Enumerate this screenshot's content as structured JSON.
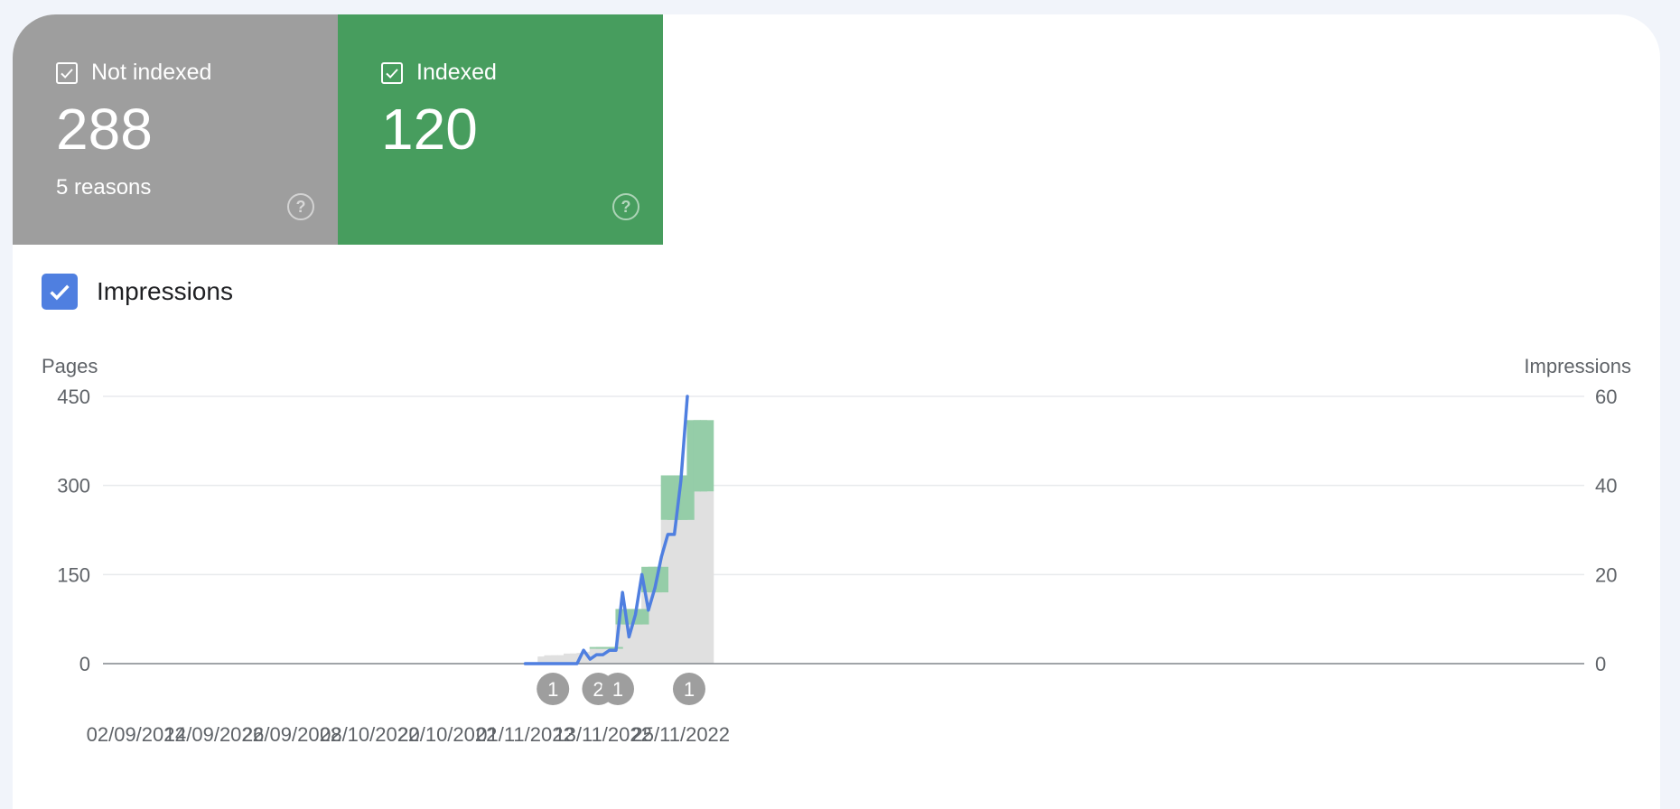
{
  "tiles": {
    "not_indexed": {
      "label": "Not indexed",
      "value": "288",
      "sub": "5 reasons",
      "checked": true,
      "color": "#9e9e9e"
    },
    "indexed": {
      "label": "Indexed",
      "value": "120",
      "checked": true,
      "color": "#479d5e"
    }
  },
  "toggle": {
    "label": "Impressions",
    "checked": true,
    "color": "#4f7fe0"
  },
  "chart_data": {
    "type": "bar",
    "y_left_label": "Pages",
    "y_right_label": "Impressions",
    "y_left_ticks": [
      "450",
      "300",
      "150",
      "0"
    ],
    "y_right_ticks": [
      "60",
      "40",
      "20",
      "0"
    ],
    "ylim_left": [
      0,
      450
    ],
    "ylim_right": [
      0,
      60
    ],
    "x_tick_labels": [
      "02/09/2022",
      "14/09/2022",
      "26/09/2022",
      "08/10/2022",
      "20/10/2022",
      "01/11/2022",
      "13/11/2022",
      "25/11/2022"
    ],
    "x_start": "2022-09-01",
    "x_end": "2022-11-30",
    "grid": true,
    "series": [
      {
        "name": "Not indexed",
        "color": "#e0e0e0",
        "points": [
          [
            "2022-11-04",
            12
          ],
          [
            "2022-11-05",
            14
          ],
          [
            "2022-11-06",
            14
          ],
          [
            "2022-11-07",
            14
          ],
          [
            "2022-11-08",
            17
          ],
          [
            "2022-11-09",
            17
          ],
          [
            "2022-11-10",
            18
          ],
          [
            "2022-11-11",
            20
          ],
          [
            "2022-11-12",
            25
          ],
          [
            "2022-11-13",
            25
          ],
          [
            "2022-11-14",
            25
          ],
          [
            "2022-11-15",
            25
          ],
          [
            "2022-11-16",
            66
          ],
          [
            "2022-11-17",
            66
          ],
          [
            "2022-11-18",
            66
          ],
          [
            "2022-11-19",
            66
          ],
          [
            "2022-11-20",
            120
          ],
          [
            "2022-11-21",
            120
          ],
          [
            "2022-11-22",
            120
          ],
          [
            "2022-11-23",
            242
          ],
          [
            "2022-11-24",
            242
          ],
          [
            "2022-11-25",
            242
          ],
          [
            "2022-11-26",
            242
          ],
          [
            "2022-11-27",
            290
          ],
          [
            "2022-11-28",
            290
          ],
          [
            "2022-11-29",
            290
          ]
        ]
      },
      {
        "name": "Indexed",
        "color": "#95cda8",
        "points": [
          [
            "2022-11-12",
            3
          ],
          [
            "2022-11-13",
            3
          ],
          [
            "2022-11-14",
            3
          ],
          [
            "2022-11-15",
            3
          ],
          [
            "2022-11-16",
            26
          ],
          [
            "2022-11-17",
            26
          ],
          [
            "2022-11-18",
            26
          ],
          [
            "2022-11-19",
            26
          ],
          [
            "2022-11-20",
            43
          ],
          [
            "2022-11-21",
            43
          ],
          [
            "2022-11-22",
            43
          ],
          [
            "2022-11-23",
            75
          ],
          [
            "2022-11-24",
            75
          ],
          [
            "2022-11-25",
            75
          ],
          [
            "2022-11-26",
            75
          ],
          [
            "2022-11-27",
            120
          ],
          [
            "2022-11-28",
            120
          ],
          [
            "2022-11-29",
            120
          ]
        ]
      },
      {
        "name": "Impressions",
        "color": "#4f7fe0",
        "axis": "right",
        "points": [
          [
            "2022-11-01",
            0
          ],
          [
            "2022-11-02",
            0
          ],
          [
            "2022-11-03",
            0
          ],
          [
            "2022-11-04",
            0
          ],
          [
            "2022-11-05",
            0
          ],
          [
            "2022-11-06",
            0
          ],
          [
            "2022-11-07",
            0
          ],
          [
            "2022-11-08",
            0
          ],
          [
            "2022-11-09",
            0
          ],
          [
            "2022-11-10",
            3
          ],
          [
            "2022-11-11",
            1
          ],
          [
            "2022-11-12",
            2
          ],
          [
            "2022-11-13",
            2
          ],
          [
            "2022-11-14",
            3
          ],
          [
            "2022-11-15",
            3
          ],
          [
            "2022-11-16",
            16
          ],
          [
            "2022-11-17",
            6
          ],
          [
            "2022-11-18",
            11
          ],
          [
            "2022-11-19",
            20
          ],
          [
            "2022-11-20",
            12
          ],
          [
            "2022-11-21",
            17
          ],
          [
            "2022-11-22",
            24
          ],
          [
            "2022-11-23",
            29
          ],
          [
            "2022-11-24",
            29
          ],
          [
            "2022-11-25",
            41
          ],
          [
            "2022-11-26",
            60
          ]
        ]
      }
    ],
    "annotations": [
      {
        "date": "2022-11-05",
        "label": "1"
      },
      {
        "date": "2022-11-12",
        "label": "2"
      },
      {
        "date": "2022-11-15",
        "label": "1"
      },
      {
        "date": "2022-11-26",
        "label": "1"
      }
    ]
  }
}
